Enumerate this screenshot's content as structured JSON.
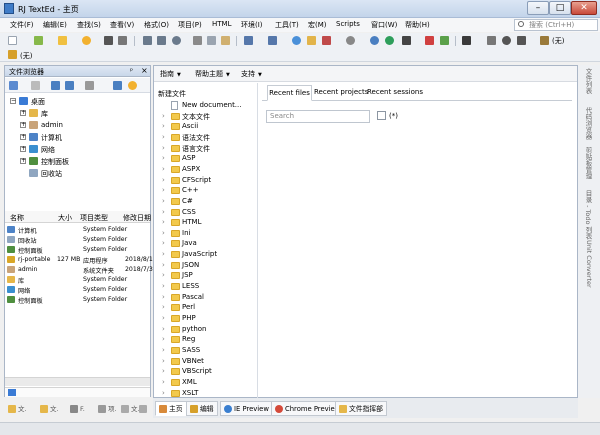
{
  "window": {
    "title": "RJ TextEd - 主页"
  },
  "menu": [
    "文件(F)",
    "编辑(E)",
    "查找(S)",
    "查看(V)",
    "格式(O)",
    "项目(P)",
    "HTML",
    "环境(I)",
    "工具(T)",
    "宏(M)",
    "Scripts",
    "窗口(W)",
    "帮助(H)"
  ],
  "search": {
    "placeholder": "搜索 (Ctrl+H)"
  },
  "toolbar2": {
    "label": "(无)"
  },
  "file_browser": {
    "title": "文件浏览器",
    "pin": "ᵖ",
    "close": "×",
    "tree": [
      {
        "label": "桌面",
        "expanded": true
      },
      {
        "label": "库"
      },
      {
        "label": "admin"
      },
      {
        "label": "计算机"
      },
      {
        "label": "网络"
      },
      {
        "label": "控制面板"
      },
      {
        "label": "回收站"
      }
    ],
    "columns": [
      "名称",
      "大小",
      "项目类型",
      "修改日期"
    ],
    "files": [
      {
        "name": "计算机",
        "size": "",
        "type": "System Folder",
        "date": ""
      },
      {
        "name": "回收站",
        "size": "",
        "type": "System Folder",
        "date": ""
      },
      {
        "name": "控制面板",
        "size": "",
        "type": "System Folder",
        "date": ""
      },
      {
        "name": "rj-portable",
        "size": "127 MB",
        "type": "应用程序",
        "date": "2018/8/1"
      },
      {
        "name": "admin",
        "size": "",
        "type": "系统文件夹",
        "date": "2018/7/3"
      },
      {
        "name": "库",
        "size": "",
        "type": "System Folder",
        "date": ""
      },
      {
        "name": "网络",
        "size": "",
        "type": "System Folder",
        "date": ""
      },
      {
        "name": "控制面板",
        "size": "",
        "type": "System Folder",
        "date": ""
      }
    ],
    "bottom_tabs": [
      "文.",
      "文.",
      "F.",
      "项.",
      "文.",
      "文."
    ]
  },
  "main_toolbar": {
    "items": [
      "指南",
      "帮助主题",
      "支持"
    ]
  },
  "new_document": {
    "title": "新建文件",
    "items": [
      "New document...",
      "文本文件",
      "Ascii",
      "语法文件",
      "语言文件",
      "ASP",
      "ASPX",
      "CFScript",
      "C++",
      "C#",
      "CSS",
      "HTML",
      "Ini",
      "Java",
      "JavaScript",
      "JSON",
      "JSP",
      "LESS",
      "Pascal",
      "Perl",
      "PHP",
      "python",
      "Reg",
      "SASS",
      "VBNet",
      "VBScript",
      "XML",
      "XSLT"
    ]
  },
  "recent": {
    "tabs": [
      "Recent files",
      "Recent projects",
      "Recent sessions"
    ],
    "search_placeholder": "Search",
    "filter_label": "(*)"
  },
  "right_dock": [
    "文件列表",
    "代码浏览器",
    "剪贴板管理",
    "目录 - Todo 列表",
    "Unit Converter"
  ],
  "bottom_tabs": [
    "主页",
    "编辑",
    "IE Preview",
    "Chrome Preview",
    "文件指挥部"
  ]
}
